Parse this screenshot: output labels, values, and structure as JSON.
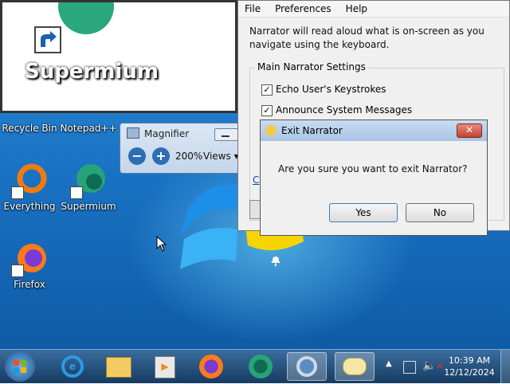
{
  "desktop": {
    "icons": [
      {
        "label": "Recycle Bin"
      },
      {
        "label": "Notepad++"
      },
      {
        "label": "Everything"
      },
      {
        "label": "Supermium"
      },
      {
        "label": "Firefox"
      }
    ]
  },
  "magnified_view": {
    "label": "Supermium"
  },
  "magnifier": {
    "title": "Magnifier",
    "zoom": "200%",
    "views_label": "Views"
  },
  "narrator": {
    "menu": [
      "File",
      "Preferences",
      "Help"
    ],
    "description": "Narrator will read aloud what is on-screen as you navigate using the keyboard.",
    "group_label": "Main Narrator Settings",
    "options": [
      {
        "label": "Echo User's Keystrokes",
        "checked": true
      },
      {
        "label": "Announce System Messages",
        "checked": true
      }
    ],
    "partial_link": "C"
  },
  "dialog": {
    "title": "Exit Narrator",
    "message": "Are you sure you want to exit Narrator?",
    "yes_label": "Yes",
    "no_label": "No"
  },
  "taskbar": {
    "items": [
      "start",
      "internet-explorer",
      "file-explorer",
      "media-player",
      "firefox",
      "supermium",
      "magnifier",
      "narrator"
    ],
    "clock_time": "10:39 AM",
    "clock_date": "12/12/2024"
  }
}
